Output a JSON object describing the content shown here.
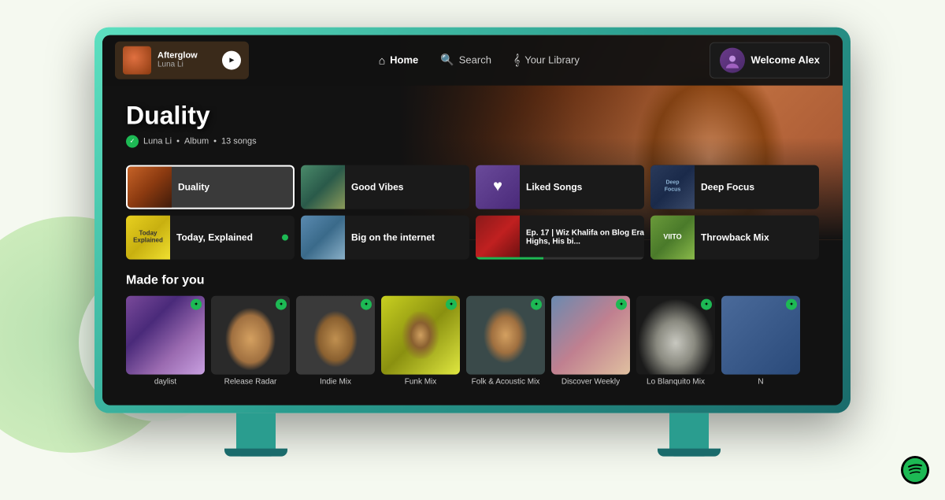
{
  "app": {
    "title": "Spotify TV"
  },
  "nav": {
    "home_label": "Home",
    "search_label": "Search",
    "library_label": "Your Library",
    "welcome_text": "Welcome Alex"
  },
  "now_playing": {
    "title": "Afterglow",
    "artist": "Luna Li"
  },
  "hero": {
    "album_title": "Duality",
    "artist": "Luna Li",
    "album_type": "Album",
    "song_count": "13 songs"
  },
  "cards": [
    {
      "label": "Duality",
      "active": true
    },
    {
      "label": "Good Vibes",
      "active": false
    },
    {
      "label": "Liked Songs",
      "active": false
    },
    {
      "label": "Deep Focus",
      "active": false
    },
    {
      "label": "Today, Explained",
      "active": false,
      "dot": true
    },
    {
      "label": "Big on the internet",
      "active": false
    },
    {
      "label": "Ep. 17 | Wiz Khalifa on Blog Era Highs, His bi...",
      "active": false
    },
    {
      "label": "Throwback Mix",
      "active": false
    }
  ],
  "made_for_you": {
    "section_title": "Made for you",
    "playlists": [
      {
        "name": "daylist",
        "badge": true
      },
      {
        "name": "Release Radar",
        "badge": true
      },
      {
        "name": "Indie Mix",
        "badge": true
      },
      {
        "name": "Funk Mix",
        "badge": true
      },
      {
        "name": "Folk & Acoustic Mix",
        "badge": true
      },
      {
        "name": "Discover Weekly",
        "badge": true
      },
      {
        "name": "Lo Blanquito Mix",
        "badge": true
      },
      {
        "name": "N",
        "badge": true
      }
    ]
  }
}
